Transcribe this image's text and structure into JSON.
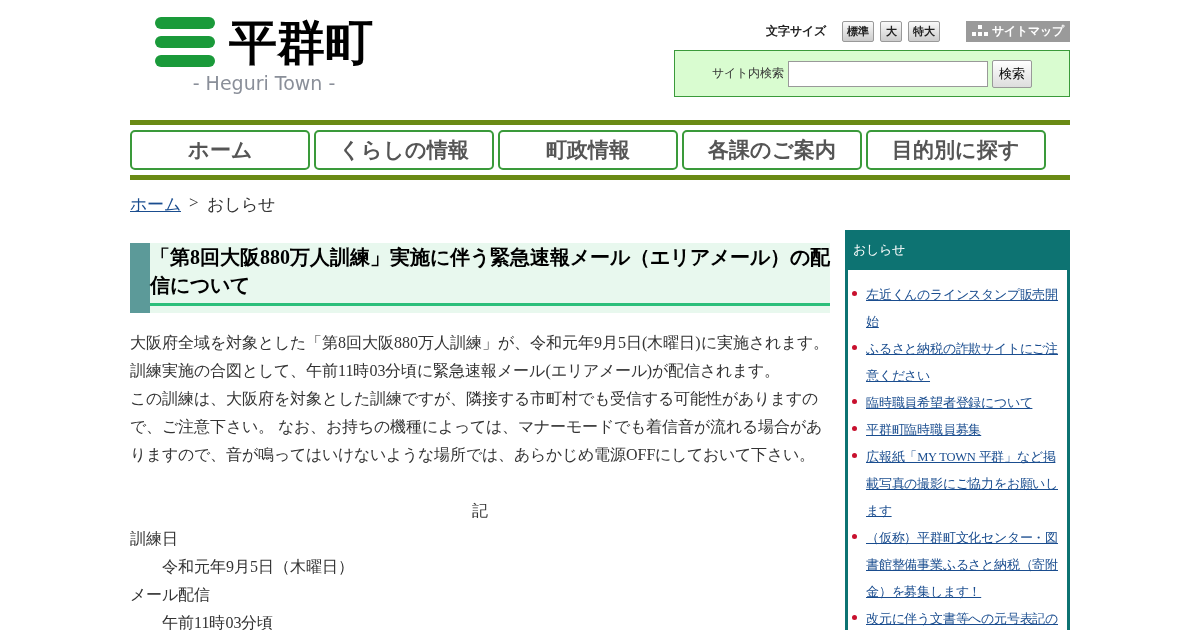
{
  "header": {
    "logo": {
      "name": "平群町",
      "subtitle": "- Heguri Town -"
    },
    "font_size": {
      "label": "文字サイズ",
      "buttons": [
        "標準",
        "大",
        "特大"
      ]
    },
    "sitemap": "サイトマップ",
    "search": {
      "label": "サイト内検索",
      "button": "検索"
    }
  },
  "nav": [
    "ホーム",
    "くらしの情報",
    "町政情報",
    "各課のご案内",
    "目的別に探す"
  ],
  "breadcrumb": {
    "link": "ホーム",
    "separator": ">",
    "current": "おしらせ"
  },
  "article": {
    "title": "「第8回大阪880万人訓練」実施に伴う緊急速報メール（エリアメール）の配信について",
    "paragraphs": [
      "大阪府全域を対象とした「第8回大阪880万人訓練」が、令和元年9月5日(木曜日)に実施されます。",
      "訓練実施の合図として、午前11時03分頃に緊急速報メール(エリアメール)が配信されます。",
      "この訓練は、大阪府を対象とした訓練ですが、隣接する市町村でも受信する可能性がありますので、ご注意下さい。 なお、お持ちの機種によっては、マナーモードでも着信音が流れる場合がありますので、音が鳴ってはいけないような場所では、あらかじめ電源OFFにしておいて下さい。"
    ],
    "note_heading": "記",
    "details": [
      {
        "term": "訓練日",
        "value": "令和元年9月5日（木曜日）"
      },
      {
        "term": "メール配信",
        "value": "午前11時03分頃"
      }
    ]
  },
  "sidebar": {
    "title": "おしらせ",
    "items": [
      "左近くんのラインスタンプ販売開始",
      "ふるさと納税の詐欺サイトにご注意ください",
      "臨時職員希望者登録について",
      "平群町臨時職員募集",
      "広報紙「MY TOWN 平群」など掲載写真の撮影にご協力をお願いします",
      "（仮称）平群町文化センター・図書館整備事業ふるさと納税（寄附金）を募集します！",
      "改元に伴う文書等への元号表記の"
    ]
  }
}
